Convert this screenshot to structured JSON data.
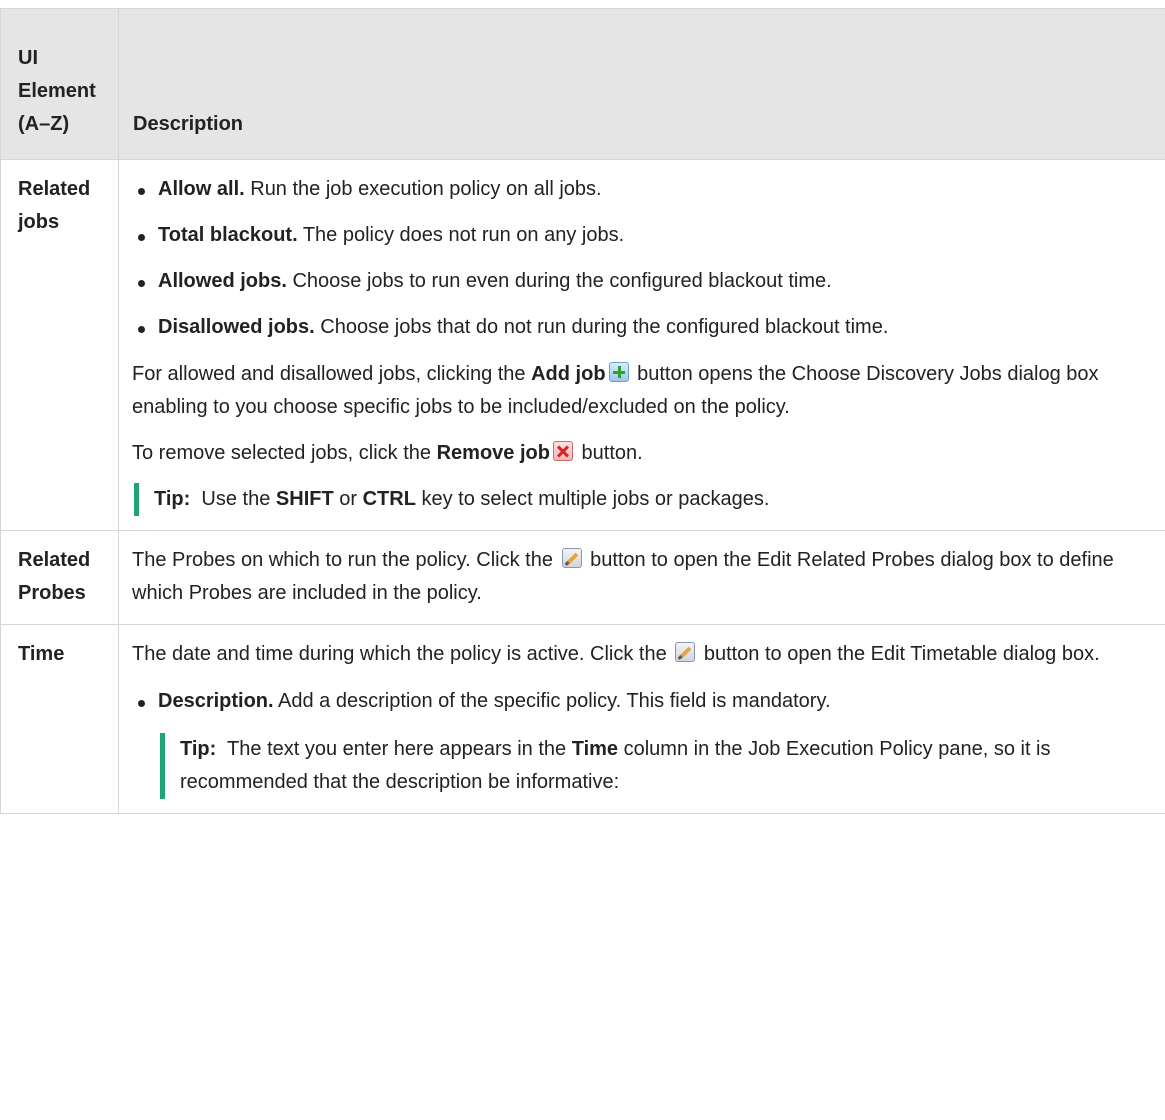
{
  "header": {
    "col1": "UI Element (A–Z)",
    "col2": "Description"
  },
  "rows": [
    {
      "name": "Related jobs",
      "bullets": [
        {
          "term": "Allow all.",
          "text": " Run the job execution policy on all jobs."
        },
        {
          "term": "Total blackout.",
          "text": " The policy does not run on any jobs."
        },
        {
          "term": "Allowed jobs.",
          "text": " Choose jobs to run even during the configured blackout time."
        },
        {
          "term": "Disallowed jobs.",
          "text": " Choose jobs that do not run during the configured blackout time."
        }
      ],
      "para1": {
        "pre": "For allowed and disallowed jobs, clicking the ",
        "bold": "Add job",
        "icon": "add-icon",
        "post": " button opens the Choose Discovery Jobs dialog box enabling to you choose specific jobs to be included/excluded on the policy."
      },
      "para2": {
        "pre": "To remove selected jobs, click the ",
        "bold": "Remove job",
        "icon": "remove-icon",
        "post": " button."
      },
      "tip": {
        "label": "Tip:",
        "pre": "  Use the ",
        "key1": "SHIFT",
        "mid": " or ",
        "key2": "CTRL",
        "post": " key to select multiple jobs or packages."
      }
    },
    {
      "name": "Related Probes",
      "pre": "The Probes on which to run the policy. Click the ",
      "icon": "edit-icon",
      "post": " button to open the Edit Related Probes dialog box to define which Probes are included in the policy."
    },
    {
      "name": "Time",
      "pre": "The date and time during which the policy is active. Click the ",
      "icon": "edit-icon",
      "post": " button to open the Edit Timetable dialog box.",
      "bullet": {
        "term": "Description.",
        "text": " Add a description of the specific policy. This field is mandatory."
      },
      "tip": {
        "label": "Tip:",
        "pre": "  The text you enter here appears in the ",
        "bold": "Time",
        "post": " column in the Job Execution Policy pane, so it is recommended that the description be informative:"
      }
    }
  ]
}
